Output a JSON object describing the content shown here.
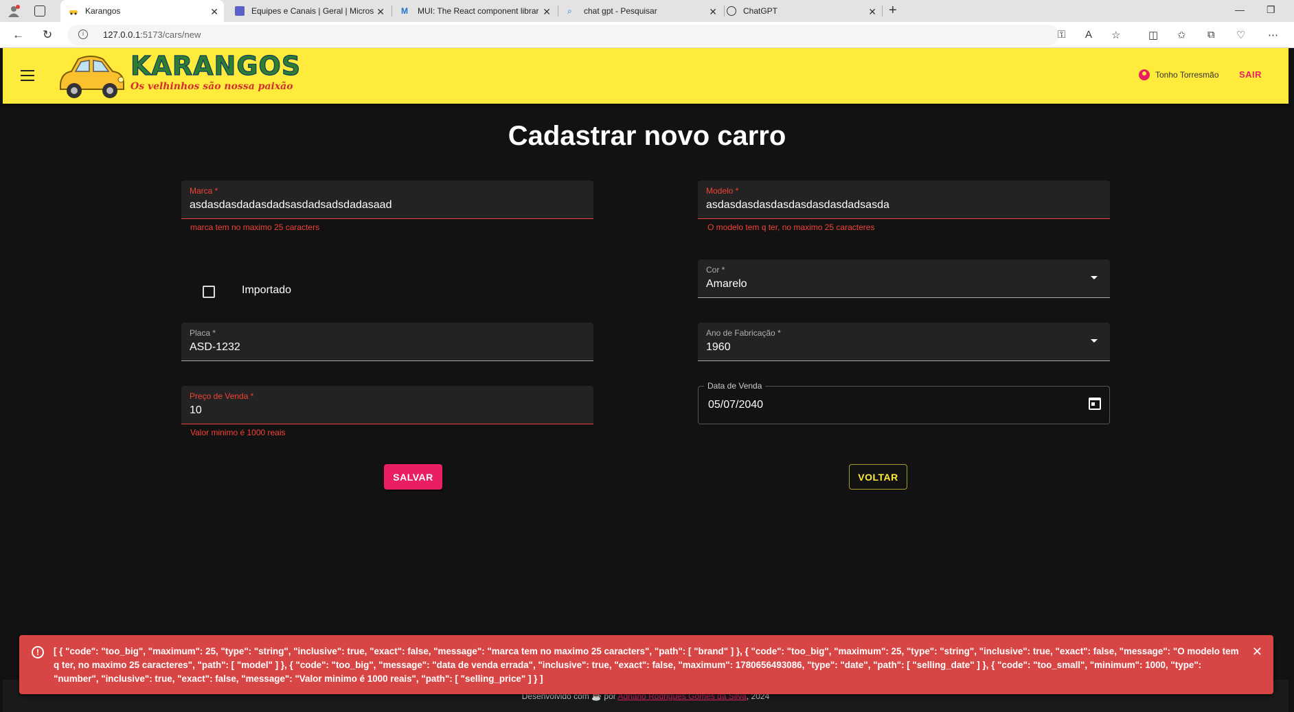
{
  "browser": {
    "tabs": [
      {
        "title": "Karangos",
        "icon": "car-favicon-icon"
      },
      {
        "title": "Equipes e Canais | Geral | Micros",
        "icon": "teams-favicon-icon"
      },
      {
        "title": "MUI: The React component librar",
        "icon": "mui-favicon-icon"
      },
      {
        "title": "chat gpt - Pesquisar",
        "icon": "search-favicon-icon"
      },
      {
        "title": "ChatGPT",
        "icon": "chatgpt-favicon-icon"
      }
    ],
    "url_host": "127.0.0.1",
    "url_path": ":5173/cars/new"
  },
  "header": {
    "logo_title": "KARANGOS",
    "logo_subtitle": "Os velhinhos são nossa paixão",
    "user_name": "Tonho Torresmão",
    "logout_label": "SAIR"
  },
  "form": {
    "title": "Cadastrar novo carro",
    "brand": {
      "label": "Marca *",
      "value": "asdasdasdadasdadsasdadsadsdadasaad",
      "error": "marca tem no maximo 25 caracters"
    },
    "model": {
      "label": "Modelo *",
      "value": "asdasdasdasdasdasdasdasdadsasda",
      "error": "O modelo tem q ter, no maximo 25 caracteres"
    },
    "imported": {
      "label": "Importado",
      "checked": false
    },
    "color": {
      "label": "Cor *",
      "value": "Amarelo"
    },
    "plate": {
      "label": "Placa *",
      "value": "ASD-1232"
    },
    "year": {
      "label": "Ano de Fabricação *",
      "value": "1960"
    },
    "price": {
      "label": "Preço de Venda *",
      "value": "10",
      "error": "Valor minimo é 1000 reais"
    },
    "sale_date": {
      "label": "Data de Venda",
      "value": "05/07/2040"
    },
    "save_label": "SALVAR",
    "back_label": "VOLTAR"
  },
  "footer": {
    "text_before": "Desenvolvido com",
    "text_by": "por",
    "author": "Adriano Rodrigues Gomes da Silva",
    "year": ", 2024"
  },
  "alert": {
    "message": "[ { \"code\": \"too_big\", \"maximum\": 25, \"type\": \"string\", \"inclusive\": true, \"exact\": false, \"message\": \"marca tem no maximo 25 caracters\", \"path\": [ \"brand\" ] }, { \"code\": \"too_big\", \"maximum\": 25, \"type\": \"string\", \"inclusive\": true, \"exact\": false, \"message\": \"O modelo tem q ter, no maximo 25 caracteres\", \"path\": [ \"model\" ] }, { \"code\": \"too_big\", \"message\": \"data de venda errada\", \"inclusive\": true, \"exact\": false, \"maximum\": 1780656493086, \"type\": \"date\", \"path\": [ \"selling_date\" ] }, { \"code\": \"too_small\", \"minimum\": 1000, \"type\": \"number\", \"inclusive\": true, \"exact\": false, \"message\": \"Valor minimo é 1000 reais\", \"path\": [ \"selling_price\" ] } ]"
  },
  "colors": {
    "appbar": "#ffeb3b",
    "primary": "#e91e63",
    "error": "#f44336",
    "alert_bg": "#d84545",
    "background": "#121212"
  }
}
